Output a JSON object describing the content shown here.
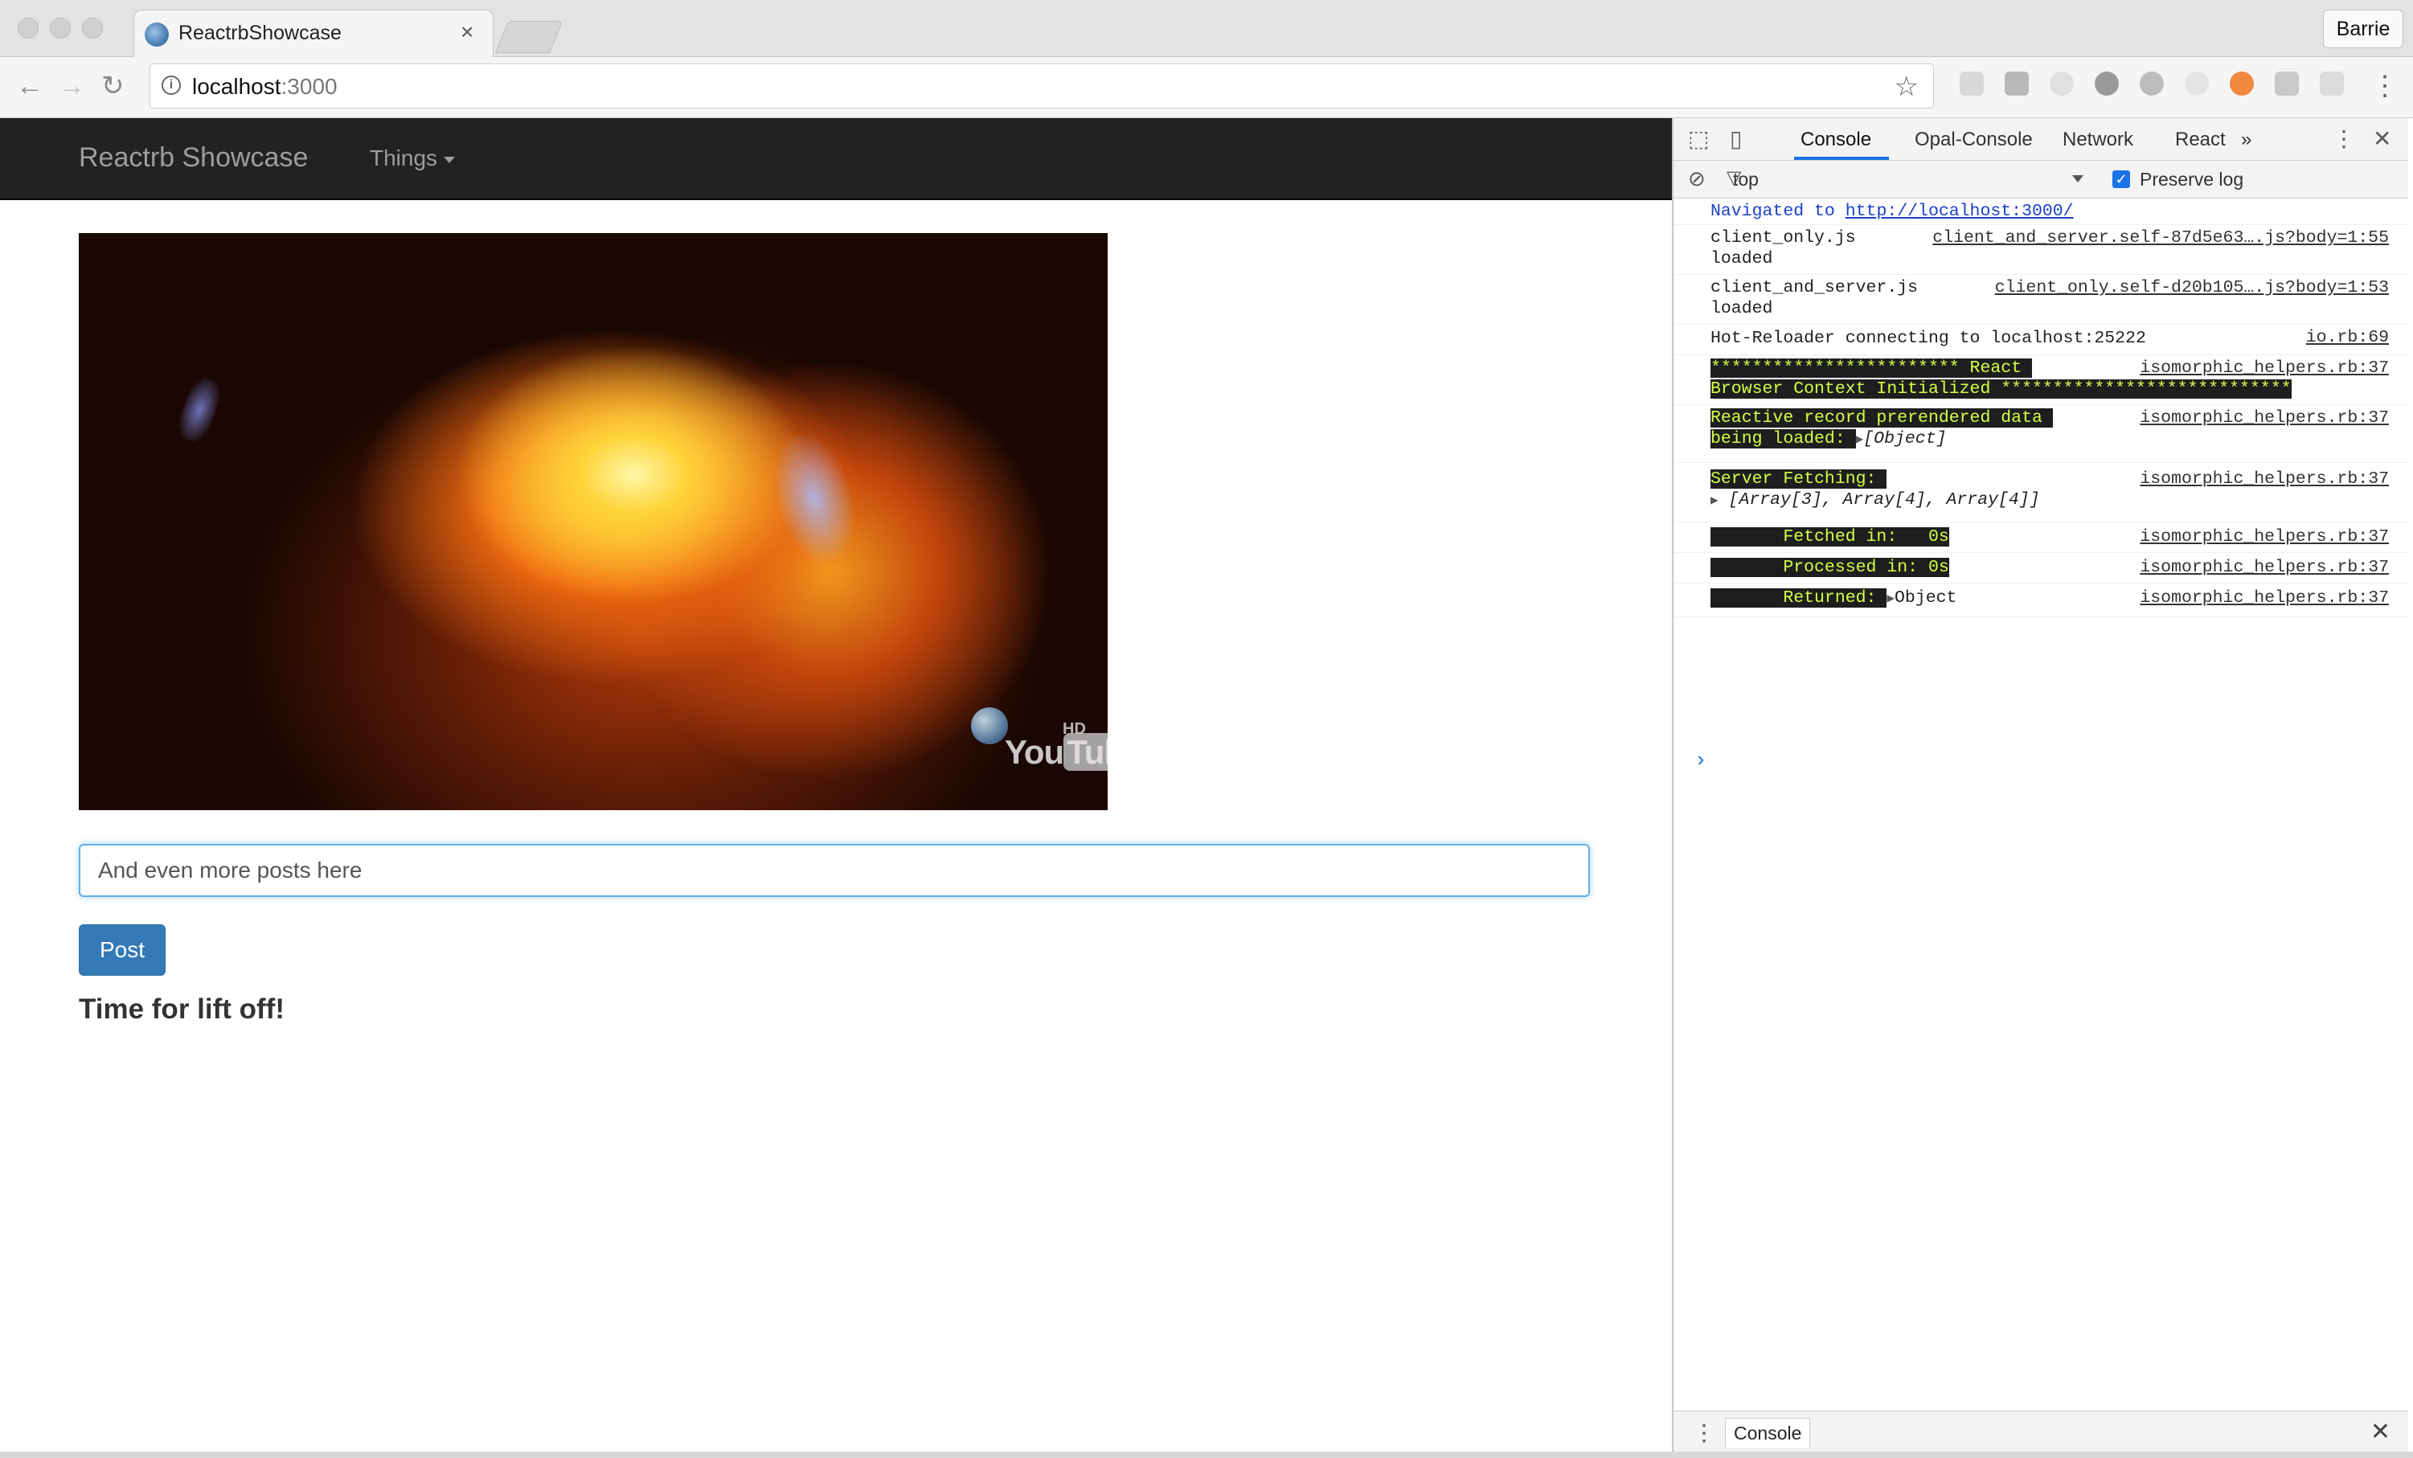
{
  "browser": {
    "tab_title": "ReactrbShowcase",
    "tab_close": "×",
    "profile": "Barrie",
    "url_host": "localhost",
    "url_port": ":3000",
    "icons": {
      "back": "←",
      "forward": "→",
      "reload": "↻",
      "star": "☆",
      "menu": "⋮",
      "info": "i"
    }
  },
  "app": {
    "brand": "Reactrb Showcase",
    "nav_dropdown": "Things",
    "post_input_value": "And even more posts here",
    "post_button": "Post",
    "heading": "Time for lift off!",
    "video_logo_word1": "You",
    "video_logo_word2": "Tube",
    "video_hd": "HD",
    "colors": {
      "navbar": "#222222",
      "primary": "#337ab7",
      "focus": "#66afe9"
    }
  },
  "devtools": {
    "tabs": [
      "Console",
      "Opal-Console",
      "Network",
      "React"
    ],
    "more_tabs": "»",
    "active_tab": "Console",
    "context": "top",
    "preserve_log": "Preserve log",
    "drawer_tab": "Console",
    "messages": {
      "nav_prefix": "Navigated to ",
      "nav_url": "http://localhost:3000/",
      "m1_text": "client_only.js",
      "m1_text2": "loaded",
      "m1_src": "client_and_server.self-87d5e63….js?body=1:55",
      "m2_text": "client_and_server.js",
      "m2_text2": "loaded",
      "m2_src": "client_only.self-d20b105….js?body=1:53",
      "m3_text": "Hot-Reloader connecting to localhost:25222",
      "m3_src": "io.rb:69",
      "m4_line1": "************************ React ",
      "m4_line2": "Browser Context Initialized ****************************",
      "m4_src": "isomorphic_helpers.rb:37",
      "m5_line1": "Reactive record prerendered data ",
      "m5_line2": "being loaded: ",
      "m5_obj": "[Object]",
      "m5_src": "isomorphic_helpers.rb:37",
      "m6_line1": "Server Fetching: ",
      "m6_obj": "[Array[3], Array[4], Array[4]]",
      "m6_src": "isomorphic_helpers.rb:37",
      "m7_label": "       Fetched in:   0s",
      "m7_src": "isomorphic_helpers.rb:37",
      "m8_label": "       Processed in: 0s",
      "m8_src": "isomorphic_helpers.rb:37",
      "m9_label": "       Returned: ",
      "m9_obj": "Object",
      "m9_src": "isomorphic_helpers.rb:37",
      "prompt": "›"
    }
  }
}
